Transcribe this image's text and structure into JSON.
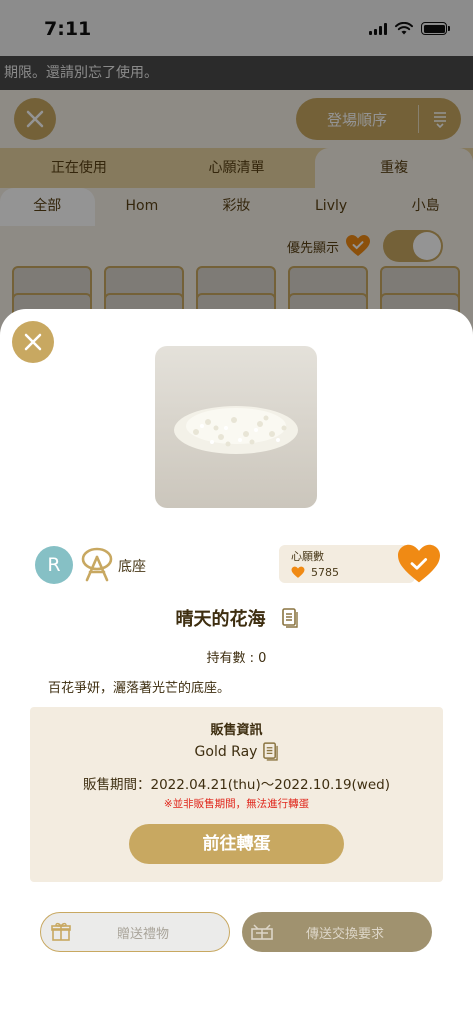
{
  "status_bar": {
    "time": "7:11"
  },
  "notice": {
    "text": "期限。還請別忘了使用。"
  },
  "background": {
    "sort_label": "登場順序",
    "tabs": [
      "正在使用",
      "心願清單",
      "重複"
    ],
    "filters": [
      "全部",
      "Hom",
      "彩妝",
      "Livly",
      "小島"
    ],
    "priority_label": "優先顯示"
  },
  "item": {
    "rarity": "R",
    "category": "底座",
    "wishlist_label": "心願數",
    "wishlist_count": "5785",
    "name": "晴天的花海",
    "owned": "持有數 : 0",
    "description": "百花爭妍，灑落著光芒的底座。"
  },
  "sale": {
    "title": "販售資訊",
    "gacha_name": "Gold Ray",
    "period": "販售期間：2022.04.21(thu)～2022.10.19(wed)",
    "warning": "※並非販售期間，無法進行轉蛋",
    "go_button": "前往轉蛋"
  },
  "actions": {
    "gift": "贈送禮物",
    "trade": "傳送交換要求"
  },
  "colors": {
    "gold": "#c8a861",
    "orange": "#f08a14",
    "rarity": "#86c0c5",
    "warning": "#e0261b"
  }
}
